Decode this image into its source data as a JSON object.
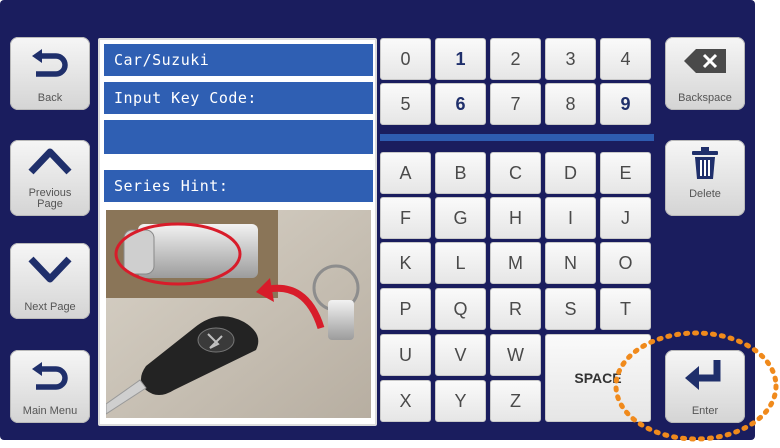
{
  "side_buttons": {
    "back": "Back",
    "previous_page": "Previous\nPage",
    "next_page": "Next Page",
    "main_menu": "Main Menu",
    "backspace": "Backspace",
    "delete": "Delete",
    "enter": "Enter"
  },
  "panel": {
    "title": "Car/Suzuki",
    "prompt": "Input Key Code:",
    "input_value": "",
    "hint_label": "Series Hint:"
  },
  "keypad": {
    "digits_row1": [
      "0",
      "1",
      "2",
      "3",
      "4"
    ],
    "digits_row2": [
      "5",
      "6",
      "7",
      "8",
      "9"
    ],
    "letters": [
      [
        "A",
        "B",
        "C",
        "D",
        "E"
      ],
      [
        "F",
        "G",
        "H",
        "I",
        "J"
      ],
      [
        "K",
        "L",
        "M",
        "N",
        "O"
      ],
      [
        "P",
        "Q",
        "R",
        "S",
        "T"
      ],
      [
        "U",
        "V",
        "W"
      ],
      [
        "X",
        "Y",
        "Z"
      ]
    ],
    "space": "SPACE"
  },
  "colors": {
    "screen_bg": "#1a1d5e",
    "bar_blue": "#2f5fb3",
    "highlight_orange": "#f08a1c"
  }
}
